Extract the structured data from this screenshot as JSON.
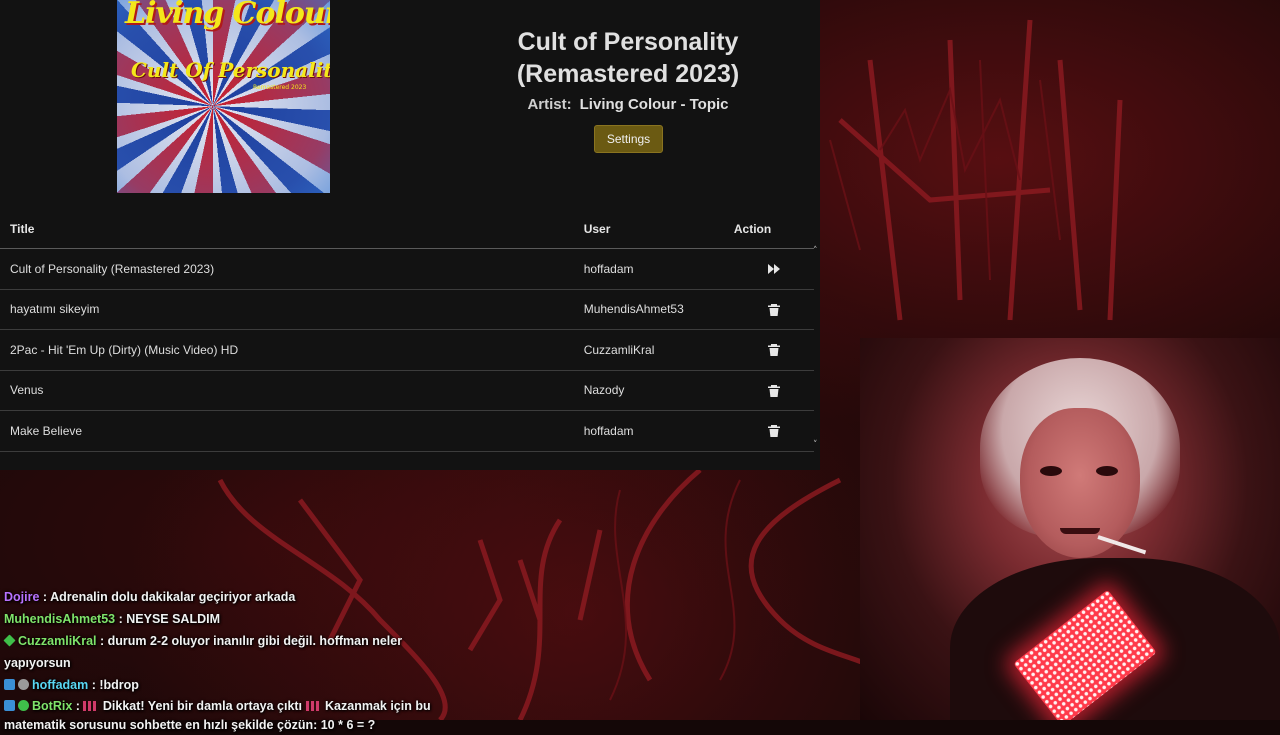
{
  "now_playing": {
    "album_band_text": "Living Colour",
    "album_title_text": "Cult Of Personality",
    "album_sub_text": "Remastered 2023",
    "title": "Cult of Personality (Remastered 2023)",
    "artist_label": "Artist:",
    "artist": "Living Colour - Topic",
    "settings_label": "Settings"
  },
  "queue": {
    "headers": {
      "title": "Title",
      "user": "User",
      "action": "Action"
    },
    "rows": [
      {
        "title": "Cult of Personality (Remastered 2023)",
        "user": "hoffadam",
        "action_icon": "skip-forward-icon"
      },
      {
        "title": "hayatımı sikeyim",
        "user": "MuhendisAhmet53",
        "action_icon": "trash-icon"
      },
      {
        "title": "2Pac - Hit 'Em Up (Dirty) (Music Video) HD",
        "user": "CuzzamliKral",
        "action_icon": "trash-icon"
      },
      {
        "title": "Venus",
        "user": "Nazody",
        "action_icon": "trash-icon"
      },
      {
        "title": "Make Believe",
        "user": "hoffadam",
        "action_icon": "trash-icon"
      }
    ],
    "scroll_up": "˄",
    "scroll_down": "˅"
  },
  "chat": [
    {
      "user": "Dojire",
      "color": "#b872ff",
      "separator": " : ",
      "message": "Adrenalin dolu dakikalar geçiriyor arkada"
    },
    {
      "user": "MuhendisAhmet53",
      "color": "#7fe36a",
      "separator": " : ",
      "message": "NEYSE SALDIM"
    },
    {
      "user": "CuzzamliKral",
      "color": "#7fe36a",
      "separator": " : ",
      "message": "durum 2-2 oluyor inanılır gibi değil. hoffman neler yapıyorsun"
    },
    {
      "user": "hoffadam",
      "color": "#59d6f2",
      "separator": " : ",
      "message": "!bdrop"
    },
    {
      "user": "BotRix",
      "color": "#7fe36a",
      "separator": " : ",
      "message_part1": "Dikkat! Yeni bir damla ortaya çıktı",
      "message_part2": "Kazanmak için bu matematik sorusunu sohbette en hızlı şekilde çözün: 10 * 6 = ?"
    }
  ],
  "colors": {
    "settings_button": "#6b5a12",
    "panel": "#121212",
    "background_art": "#160808"
  }
}
